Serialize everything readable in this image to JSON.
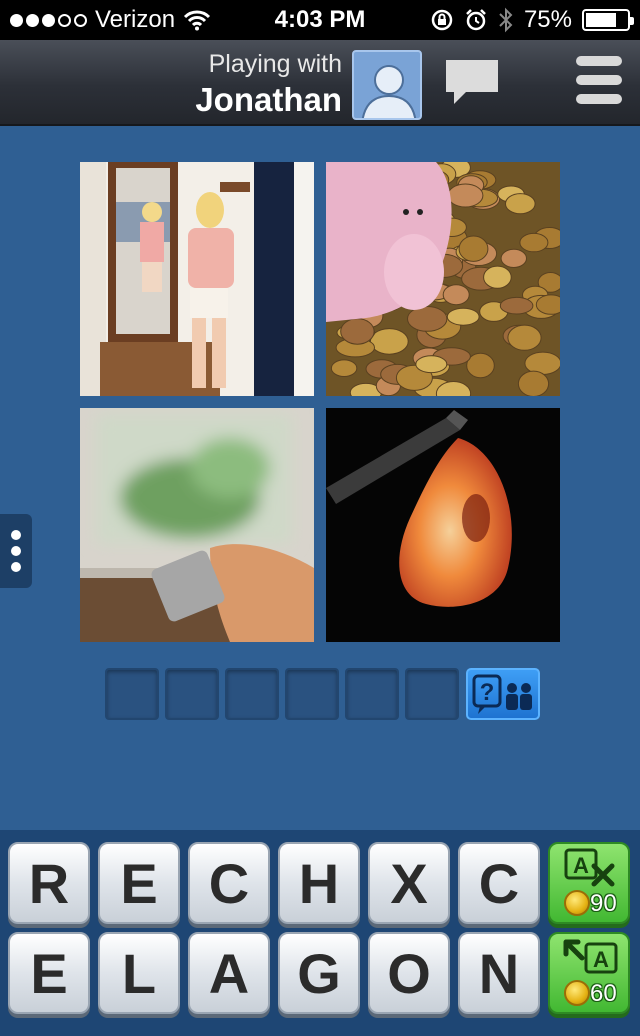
{
  "status_bar": {
    "carrier": "Verizon",
    "time": "4:03 PM",
    "battery": "75%",
    "battery_level": 0.75,
    "signal_bars_filled": 3,
    "signal_bars_total": 5
  },
  "header": {
    "subtitle": "Playing with",
    "opponent_name": "Jonathan"
  },
  "puzzle": {
    "images": [
      {
        "id": "photo-1",
        "icon": "woman-trying-on-clothes-mirror"
      },
      {
        "id": "photo-2",
        "icon": "piggy-bank-coins"
      },
      {
        "id": "photo-3",
        "icon": "tv-remote"
      },
      {
        "id": "photo-4",
        "icon": "chrysalis"
      }
    ],
    "answer_slots": 6
  },
  "keyboard": {
    "row1": [
      "R",
      "E",
      "C",
      "H",
      "X",
      "C"
    ],
    "row2": [
      "E",
      "L",
      "A",
      "G",
      "O",
      "N"
    ]
  },
  "powerups": {
    "remove_letters_cost": "90",
    "reveal_letter_cost": "60"
  },
  "colors": {
    "background": "#2f5f93",
    "keyboard_background": "#1e4674",
    "powerup_green": "#42b832",
    "help_blue": "#1e73d1"
  }
}
